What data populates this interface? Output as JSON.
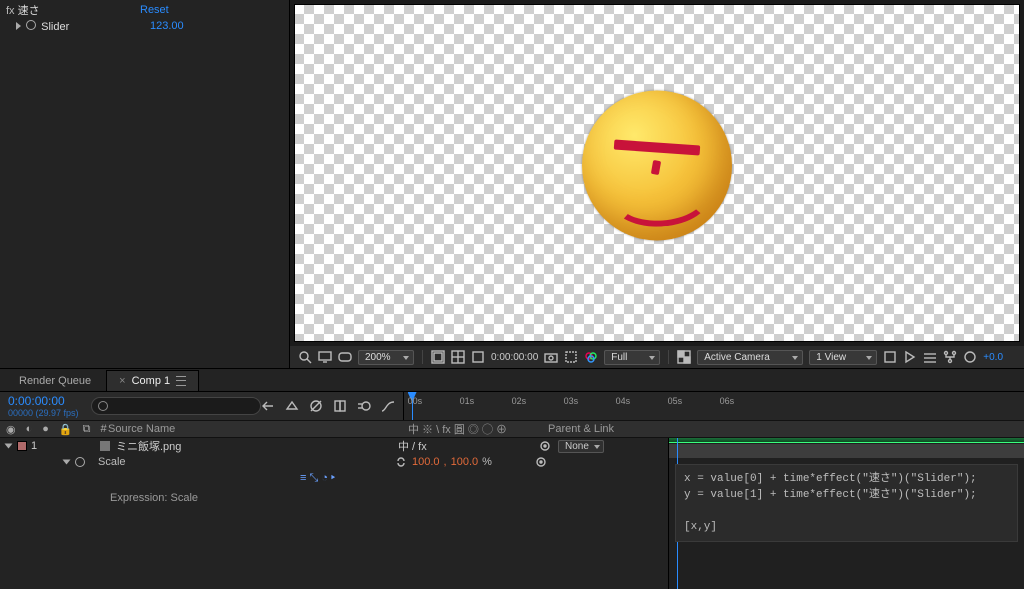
{
  "effects": {
    "fx_prefix": "fx",
    "name": "速さ",
    "reset": "Reset",
    "slider_label": "Slider",
    "slider_value": "123.00"
  },
  "viewer": {
    "zoom": "200%",
    "time": "0:00:00:00",
    "resolution": "Full",
    "camera": "Active Camera",
    "view": "1 View",
    "exposure": "+0.0"
  },
  "tabs": {
    "render_queue": "Render Queue",
    "comp": "Comp 1"
  },
  "timeline": {
    "timecode": "0:00:00:00",
    "frame_info": "00000 (29.97 fps)",
    "search_placeholder": "",
    "ruler_ticks": [
      "00s",
      "01s",
      "02s",
      "03s",
      "04s",
      "05s",
      "06s"
    ],
    "col_hash": "#",
    "col_source": "Source Name",
    "col_switches": "中 ※ \\ fx 圓 ◎ ◯ ⊕",
    "col_parent": "Parent & Link",
    "layer": {
      "index": "1",
      "name": "ミニ飯塚.png",
      "switches": "中    / fx",
      "parent_none": "None",
      "prop": "Scale",
      "scale_x": "100.0",
      "scale_sep": ",",
      "scale_y": "100.0",
      "scale_pct": "%",
      "expr_icons": "≡ ⤡ ◔ ▸",
      "expr_label": "Expression: Scale"
    },
    "expression": "x = value[0] + time*effect(\"速さ\")(\"Slider\");\ny = value[1] + time*effect(\"速さ\")(\"Slider\");\n\n[x,y]"
  }
}
